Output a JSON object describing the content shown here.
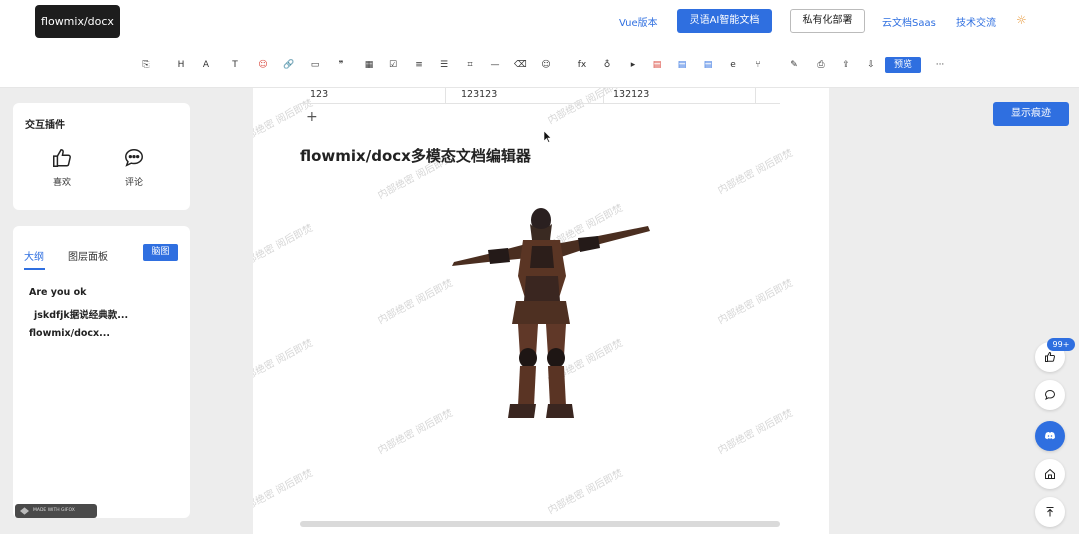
{
  "header": {
    "logo": "flowmix/docx",
    "vue_link": "Vue版本",
    "ai_doc_button": "灵语AI智能文档",
    "private_deploy_button": "私有化部署",
    "cloud_saas_link": "云文档Saas",
    "tech_link": "技术交流",
    "theme_icon": "sun-icon"
  },
  "toolbar": {
    "icons": [
      {
        "name": "format-painter-icon",
        "glyph": "⎘"
      },
      {
        "name": "heading-icon",
        "glyph": "H"
      },
      {
        "name": "font-icon",
        "glyph": "A"
      },
      {
        "name": "text-size-icon",
        "glyph": "T"
      },
      {
        "name": "emoji-icon",
        "glyph": "☺"
      },
      {
        "name": "link-icon",
        "glyph": "🔗"
      },
      {
        "name": "image-icon",
        "glyph": "▭"
      },
      {
        "name": "quote-icon",
        "glyph": "❞"
      },
      {
        "name": "table-icon",
        "glyph": "▦"
      },
      {
        "name": "checkbox-icon",
        "glyph": "☑"
      },
      {
        "name": "ordered-list-icon",
        "glyph": "≡"
      },
      {
        "name": "bullet-list-icon",
        "glyph": "☰"
      },
      {
        "name": "code-icon",
        "glyph": "⌗"
      },
      {
        "name": "divider-icon",
        "glyph": "—"
      },
      {
        "name": "clear-format-icon",
        "glyph": "⌫"
      },
      {
        "name": "emoticon-icon",
        "glyph": "☺"
      },
      {
        "name": "formula-icon",
        "glyph": "fx"
      },
      {
        "name": "mic-icon",
        "glyph": "♁"
      },
      {
        "name": "video-icon",
        "glyph": "▸"
      },
      {
        "name": "pdf-icon",
        "glyph": "▤"
      },
      {
        "name": "word-icon",
        "glyph": "▤"
      },
      {
        "name": "doc-icon",
        "glyph": "▤"
      },
      {
        "name": "edge-icon",
        "glyph": "e"
      },
      {
        "name": "branch-icon",
        "glyph": "⑂"
      },
      {
        "name": "erase-icon",
        "glyph": "✎"
      },
      {
        "name": "print-icon",
        "glyph": "⎙"
      },
      {
        "name": "export-icon",
        "glyph": "⇪"
      },
      {
        "name": "download-icon",
        "glyph": "⇩"
      }
    ],
    "preview_button": "预览",
    "more": "···"
  },
  "plugins": {
    "title": "交互插件",
    "like_label": "喜欢",
    "comment_label": "评论"
  },
  "outline": {
    "tab_outline": "大纲",
    "tab_layers": "图层面板",
    "mindmap_button": "脑图",
    "items": [
      "Are you ok",
      "jskdfjk据说经典款...",
      "flowmix/docx..."
    ]
  },
  "document": {
    "table_row": [
      "123",
      "123123",
      "132123"
    ],
    "add_row": "+",
    "heading": "flowmix/docx多模态文档编辑器",
    "watermark": "内部绝密 阅后即焚"
  },
  "right_panel": {
    "show_traces_button": "显示痕迹",
    "like_count_badge": "99+"
  },
  "footer_badge": "MADE WITH GIFOX",
  "colors": {
    "accent": "#2f6fe0",
    "background": "#ededed"
  }
}
